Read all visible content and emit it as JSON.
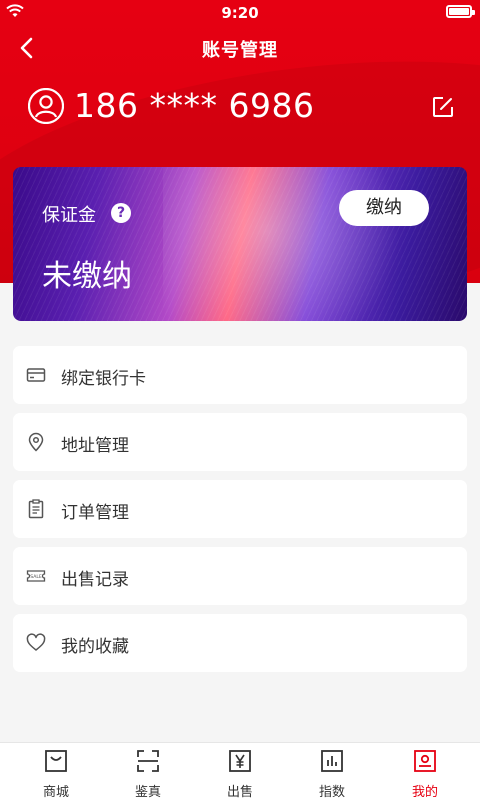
{
  "status_bar": {
    "time": "9:20"
  },
  "nav": {
    "title": "账号管理"
  },
  "account": {
    "phone": "186 **** 6986"
  },
  "deposit": {
    "label": "保证金",
    "help": "?",
    "status": "未缴纳",
    "pay_button": "缴纳"
  },
  "menu": {
    "items": [
      {
        "label": "绑定银行卡",
        "icon": "bank-card-icon"
      },
      {
        "label": "地址管理",
        "icon": "location-pin-icon"
      },
      {
        "label": "订单管理",
        "icon": "clipboard-icon"
      },
      {
        "label": "出售记录",
        "icon": "sale-ticket-icon"
      },
      {
        "label": "我的收藏",
        "icon": "heart-icon"
      }
    ]
  },
  "tabbar": {
    "tabs": [
      {
        "label": "商城",
        "icon": "shop-icon"
      },
      {
        "label": "鉴真",
        "icon": "scan-icon"
      },
      {
        "label": "出售",
        "icon": "yen-icon"
      },
      {
        "label": "指数",
        "icon": "bar-chart-icon"
      },
      {
        "label": "我的",
        "icon": "profile-icon"
      }
    ],
    "active_index": 4
  },
  "colors": {
    "brand": "#e60012",
    "card_purple": "#5a1fb0"
  }
}
